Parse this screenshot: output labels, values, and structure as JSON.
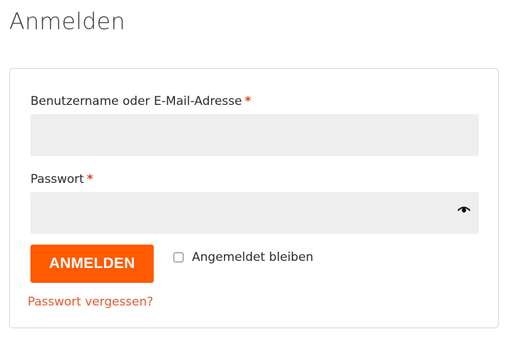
{
  "page": {
    "title": "Anmelden"
  },
  "form": {
    "username": {
      "label": "Benutzername oder E-Mail-Adresse",
      "required_mark": "*",
      "value": "",
      "placeholder": ""
    },
    "password": {
      "label": "Passwort",
      "required_mark": "*",
      "value": "",
      "placeholder": "",
      "toggle_icon": "eye-icon"
    },
    "submit_label": "ANMELDEN",
    "remember": {
      "label": "Angemeldet bleiben",
      "checked": false
    },
    "lost_password_label": "Passwort vergessen?"
  },
  "colors": {
    "accent": "#ff5a00",
    "link": "#e5582a",
    "required": "#e2401c",
    "input_background": "#eeeeee",
    "card_border": "#d6d6d6"
  }
}
